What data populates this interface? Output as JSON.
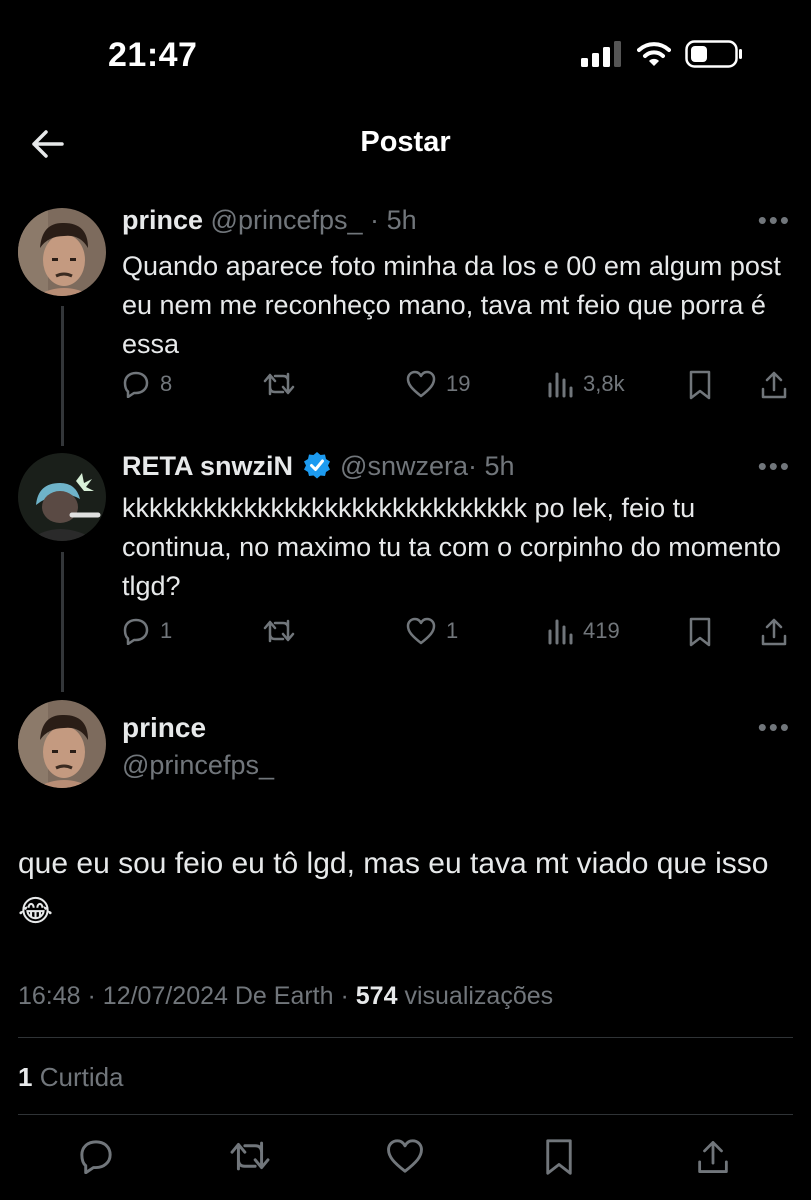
{
  "status_bar": {
    "time": "21:47"
  },
  "nav": {
    "title": "Postar"
  },
  "thread": [
    {
      "name": "prince",
      "handle": "@princefps_",
      "sep": "·",
      "age": "5h",
      "text": "Quando aparece foto minha da los e 00 em algum post eu nem me reconheço mano, tava mt feio que porra é essa",
      "replies": "8",
      "reposts": "",
      "likes": "19",
      "views": "3,8k"
    },
    {
      "name": "RETA snwziN",
      "verified": true,
      "handle": "@snwzera",
      "sep": "·",
      "age": "5h",
      "text": "kkkkkkkkkkkkkkkkkkkkkkkkkkkkkk po lek, feio tu continua, no maximo tu ta com o corpinho do momento tlgd?",
      "replies": "1",
      "reposts": "",
      "likes": "1",
      "views": "419"
    }
  ],
  "main_post": {
    "name": "prince",
    "handle": "@princefps_",
    "text": "que eu sou feio eu tô lgd, mas eu tava mt viado que isso 😂",
    "time": "16:48",
    "date": "12/07/2024",
    "source": "De Earth",
    "views_count": "574",
    "views_label": "visualizações",
    "likes_count": "1",
    "likes_label": "Curtida"
  },
  "colors": {
    "background": "#000000",
    "text": "#e7e9ea",
    "muted": "#71767b",
    "verified": "#1d9bf0",
    "divider": "#2f3336"
  },
  "icons": [
    "back-arrow-icon",
    "reply-icon",
    "repost-icon",
    "like-icon",
    "views-icon",
    "bookmark-icon",
    "share-icon",
    "verified-badge-icon",
    "more-icon"
  ]
}
